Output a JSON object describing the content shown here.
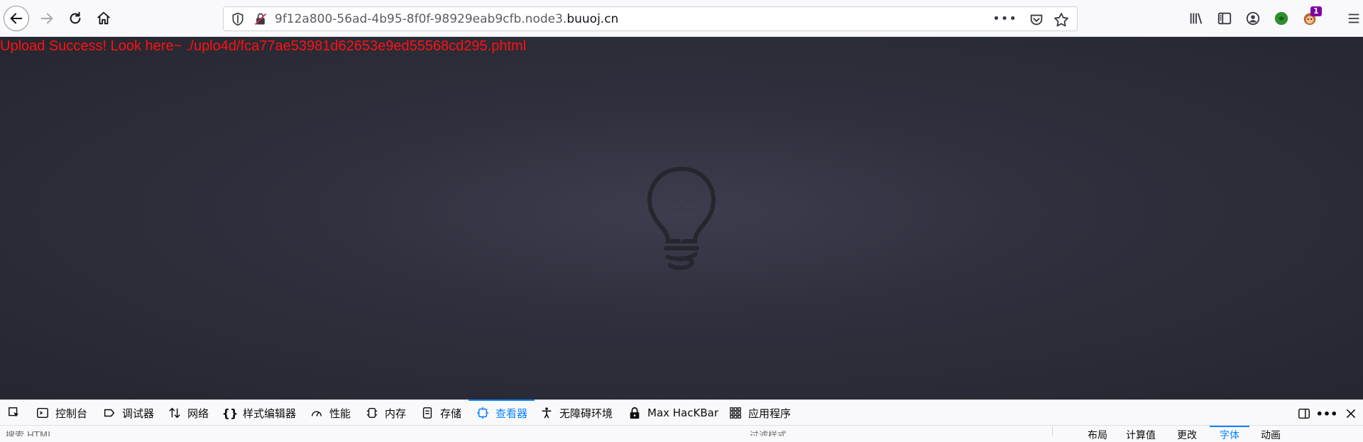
{
  "browser": {
    "url_prefix": "9f12a800-56ad-4b95-8f0f-98929eab9cfb.node3.",
    "url_domain": "buuoj.cn",
    "url_more": "•••",
    "extension_badge": "1"
  },
  "page": {
    "success_message": "Upload Success! Look here~ ./uplo4d/fca77ae53981d62653e9ed55568cd295.phtml",
    "message_color": "#ff1111"
  },
  "devtools": {
    "tabs": [
      {
        "label": "控制台",
        "icon": "console-icon"
      },
      {
        "label": "调试器",
        "icon": "debugger-icon"
      },
      {
        "label": "网络",
        "icon": "network-icon"
      },
      {
        "label": "样式编辑器",
        "icon": "style-editor-icon"
      },
      {
        "label": "性能",
        "icon": "performance-icon"
      },
      {
        "label": "内存",
        "icon": "memory-icon"
      },
      {
        "label": "存储",
        "icon": "storage-icon"
      },
      {
        "label": "查看器",
        "icon": "inspector-icon",
        "active": true
      },
      {
        "label": "无障碍环境",
        "icon": "accessibility-icon"
      },
      {
        "label": "Max HacKBar",
        "icon": "hackbar-icon"
      },
      {
        "label": "应用程序",
        "icon": "application-icon"
      }
    ],
    "search_placeholder": "搜索 HTML",
    "filter_placeholder": "过滤样式",
    "side_tabs": [
      {
        "label": "布局"
      },
      {
        "label": "计算值"
      },
      {
        "label": "更改"
      },
      {
        "label": "字体",
        "active": true
      },
      {
        "label": "动画"
      }
    ],
    "active_color": "#0a84ff"
  }
}
